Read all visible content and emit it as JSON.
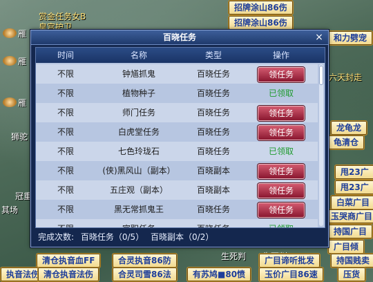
{
  "background": {
    "bg_texts": [
      {
        "id": "t1",
        "text": "赏金任务女B"
      },
      {
        "id": "t2",
        "text": "皇宫护卫"
      },
      {
        "id": "t3",
        "text": "雁"
      },
      {
        "id": "t4",
        "text": "雁"
      },
      {
        "id": "t5",
        "text": "雁"
      },
      {
        "id": "t6",
        "text": "狮驼"
      },
      {
        "id": "t7",
        "text": "冠重"
      },
      {
        "id": "t8",
        "text": "其场"
      },
      {
        "id": "t9",
        "text": "六天封走"
      },
      {
        "id": "t10",
        "text": "生死判"
      },
      {
        "id": "t11",
        "text": "生死判"
      }
    ],
    "tags": [
      {
        "id": "g1",
        "text": "招牌涂山86伤"
      },
      {
        "id": "g2",
        "text": "招牌涂山86伤"
      },
      {
        "id": "g3",
        "text": "和力劈宠"
      },
      {
        "id": "g4",
        "text": "龙龟龙"
      },
      {
        "id": "g5",
        "text": "龟清仓"
      },
      {
        "id": "g6",
        "text": "甩23广"
      },
      {
        "id": "g7",
        "text": "甩23广"
      },
      {
        "id": "g8",
        "text": "白菜广目"
      },
      {
        "id": "g9",
        "text": "玉哭商广目"
      },
      {
        "id": "g10",
        "text": "持国广目"
      },
      {
        "id": "g11",
        "text": "广目倾"
      },
      {
        "id": "g12",
        "text": "清仓执音血FF"
      },
      {
        "id": "g13",
        "text": "合灵执音86防"
      },
      {
        "id": "g14",
        "text": "广目谛听批发"
      },
      {
        "id": "g15",
        "text": "持国贱卖"
      },
      {
        "id": "g16",
        "text": "执音法伤"
      },
      {
        "id": "g17",
        "text": "清仓执音法伤"
      },
      {
        "id": "g18",
        "text": "合灵司雪86法"
      },
      {
        "id": "g19",
        "text": "有苏鸠■80愤"
      },
      {
        "id": "g20",
        "text": "玉价广目86速"
      },
      {
        "id": "g21",
        "text": "压货"
      }
    ]
  },
  "dialog": {
    "title": "百晓任务",
    "close_symbol": "×",
    "columns": [
      "时间",
      "名称",
      "类型",
      "操作"
    ],
    "rows": [
      {
        "time": "不限",
        "name": "钟馗抓鬼",
        "type": "百晓任务",
        "action": "领任务",
        "claimed": false
      },
      {
        "time": "不限",
        "name": "植物种子",
        "type": "百晓任务",
        "action": "已领取",
        "claimed": true
      },
      {
        "time": "不限",
        "name": "师门任务",
        "type": "百晓任务",
        "action": "领任务",
        "claimed": false
      },
      {
        "time": "不限",
        "name": "白虎堂任务",
        "type": "百晓任务",
        "action": "领任务",
        "claimed": false
      },
      {
        "time": "不限",
        "name": "七色玲珑石",
        "type": "百晓任务",
        "action": "已领取",
        "claimed": true
      },
      {
        "time": "不限",
        "name": "(侠)黑风山（副本）",
        "type": "百晓副本",
        "action": "领任务",
        "claimed": false
      },
      {
        "time": "不限",
        "name": "五庄观（副本）",
        "type": "百晓副本",
        "action": "领任务",
        "claimed": false
      },
      {
        "time": "不限",
        "name": "黑无常抓鬼王",
        "type": "百晓任务",
        "action": "领任务",
        "claimed": false
      },
      {
        "time": "不限",
        "name": "官职任务",
        "type": "百晓任务",
        "action": "已领取",
        "claimed": true
      }
    ],
    "footer": {
      "label": "完成次数:",
      "task": "百晓任务（0/5）",
      "dungeon": "百晓副本（0/2）"
    }
  },
  "colors": {
    "dialog_bg": "#14274e",
    "row_odd": "#cbd6ea",
    "row_even": "#b7c6e1",
    "button": "#b02a44",
    "claimed_text": "#1f9a2e",
    "tag_text": "#1e3e9a"
  }
}
